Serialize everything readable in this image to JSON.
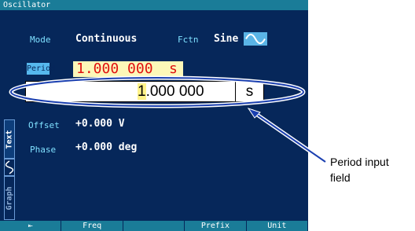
{
  "window": {
    "title": "Oscillator"
  },
  "mode": {
    "label": "Mode",
    "value": "Continuous"
  },
  "function": {
    "label": "Fctn",
    "value": "Sine",
    "icon": "sine-wave-icon"
  },
  "period": {
    "label": "Period",
    "value": "1.000 000",
    "unit": "s"
  },
  "period_input": {
    "cursor_digit": "1",
    "rest": ".000 000",
    "unit": "s"
  },
  "offset": {
    "label": "Offset",
    "value": "+0.000 V"
  },
  "phase": {
    "label": "Phase",
    "value": "+0.000 deg"
  },
  "side_tabs": {
    "text": "Text",
    "graph": "Graph"
  },
  "softkeys": [
    {
      "label": "⇤",
      "icon": "back-arrow-icon"
    },
    {
      "label": "Freq"
    },
    {
      "label": ""
    },
    {
      "label": "Prefix"
    },
    {
      "label": "Unit"
    }
  ],
  "callout": {
    "line1": "Period input",
    "line2": "field"
  },
  "colors": {
    "screen_bg": "#06275a",
    "titlebar": "#1a7c98",
    "label_cyan": "#7fe0ff",
    "highlight_blue": "#56b8ee",
    "period_value_bg": "#fdf7b8",
    "period_value_text": "#e01010",
    "annotation": "#1a3fb0"
  }
}
